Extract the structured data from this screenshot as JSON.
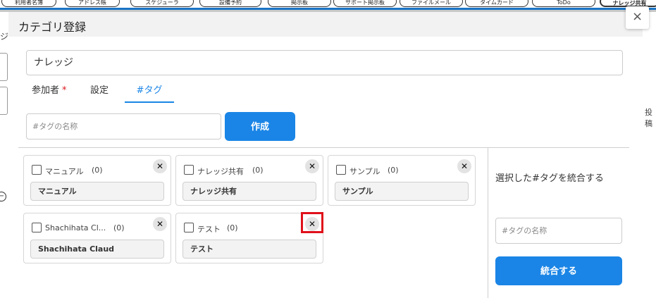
{
  "background": {
    "nav_tabs": [
      "利用者名簿",
      "アドレス帳",
      "スケジューラ",
      "設備予約",
      "掲示板",
      "サポート掲示板",
      "ファイルメール",
      "タイムカード",
      "ToDo",
      "ナレッジ共有"
    ],
    "left_fragment": "ジ",
    "right_fragment": "投稿"
  },
  "modal": {
    "title": "カテゴリ登録",
    "close_symbol": "×",
    "category_name_value": "ナレッジ",
    "tabs": [
      {
        "label": "参加者",
        "required_mark": "*"
      },
      {
        "label": "設定"
      },
      {
        "label": "#タグ"
      }
    ],
    "tag_name_placeholder": "#タグの名称",
    "create_label": "作成",
    "tags": [
      {
        "label": "マニュアル",
        "count": "(0)",
        "name": "マニュアル"
      },
      {
        "label": "ナレッジ共有",
        "count": "(0)",
        "name": "ナレッジ共有"
      },
      {
        "label": "サンプル",
        "count": "(0)",
        "name": "サンプル"
      },
      {
        "label": "Shachihata Cl...",
        "count": "(0)",
        "name": "Shachihata Claud"
      },
      {
        "label": "テスト",
        "count": "(0)",
        "name": "テスト"
      }
    ],
    "delete_symbol": "✕",
    "merge": {
      "title": "選択した#タグを統合する",
      "placeholder": "#タグの名称",
      "button_label": "統合する"
    }
  }
}
